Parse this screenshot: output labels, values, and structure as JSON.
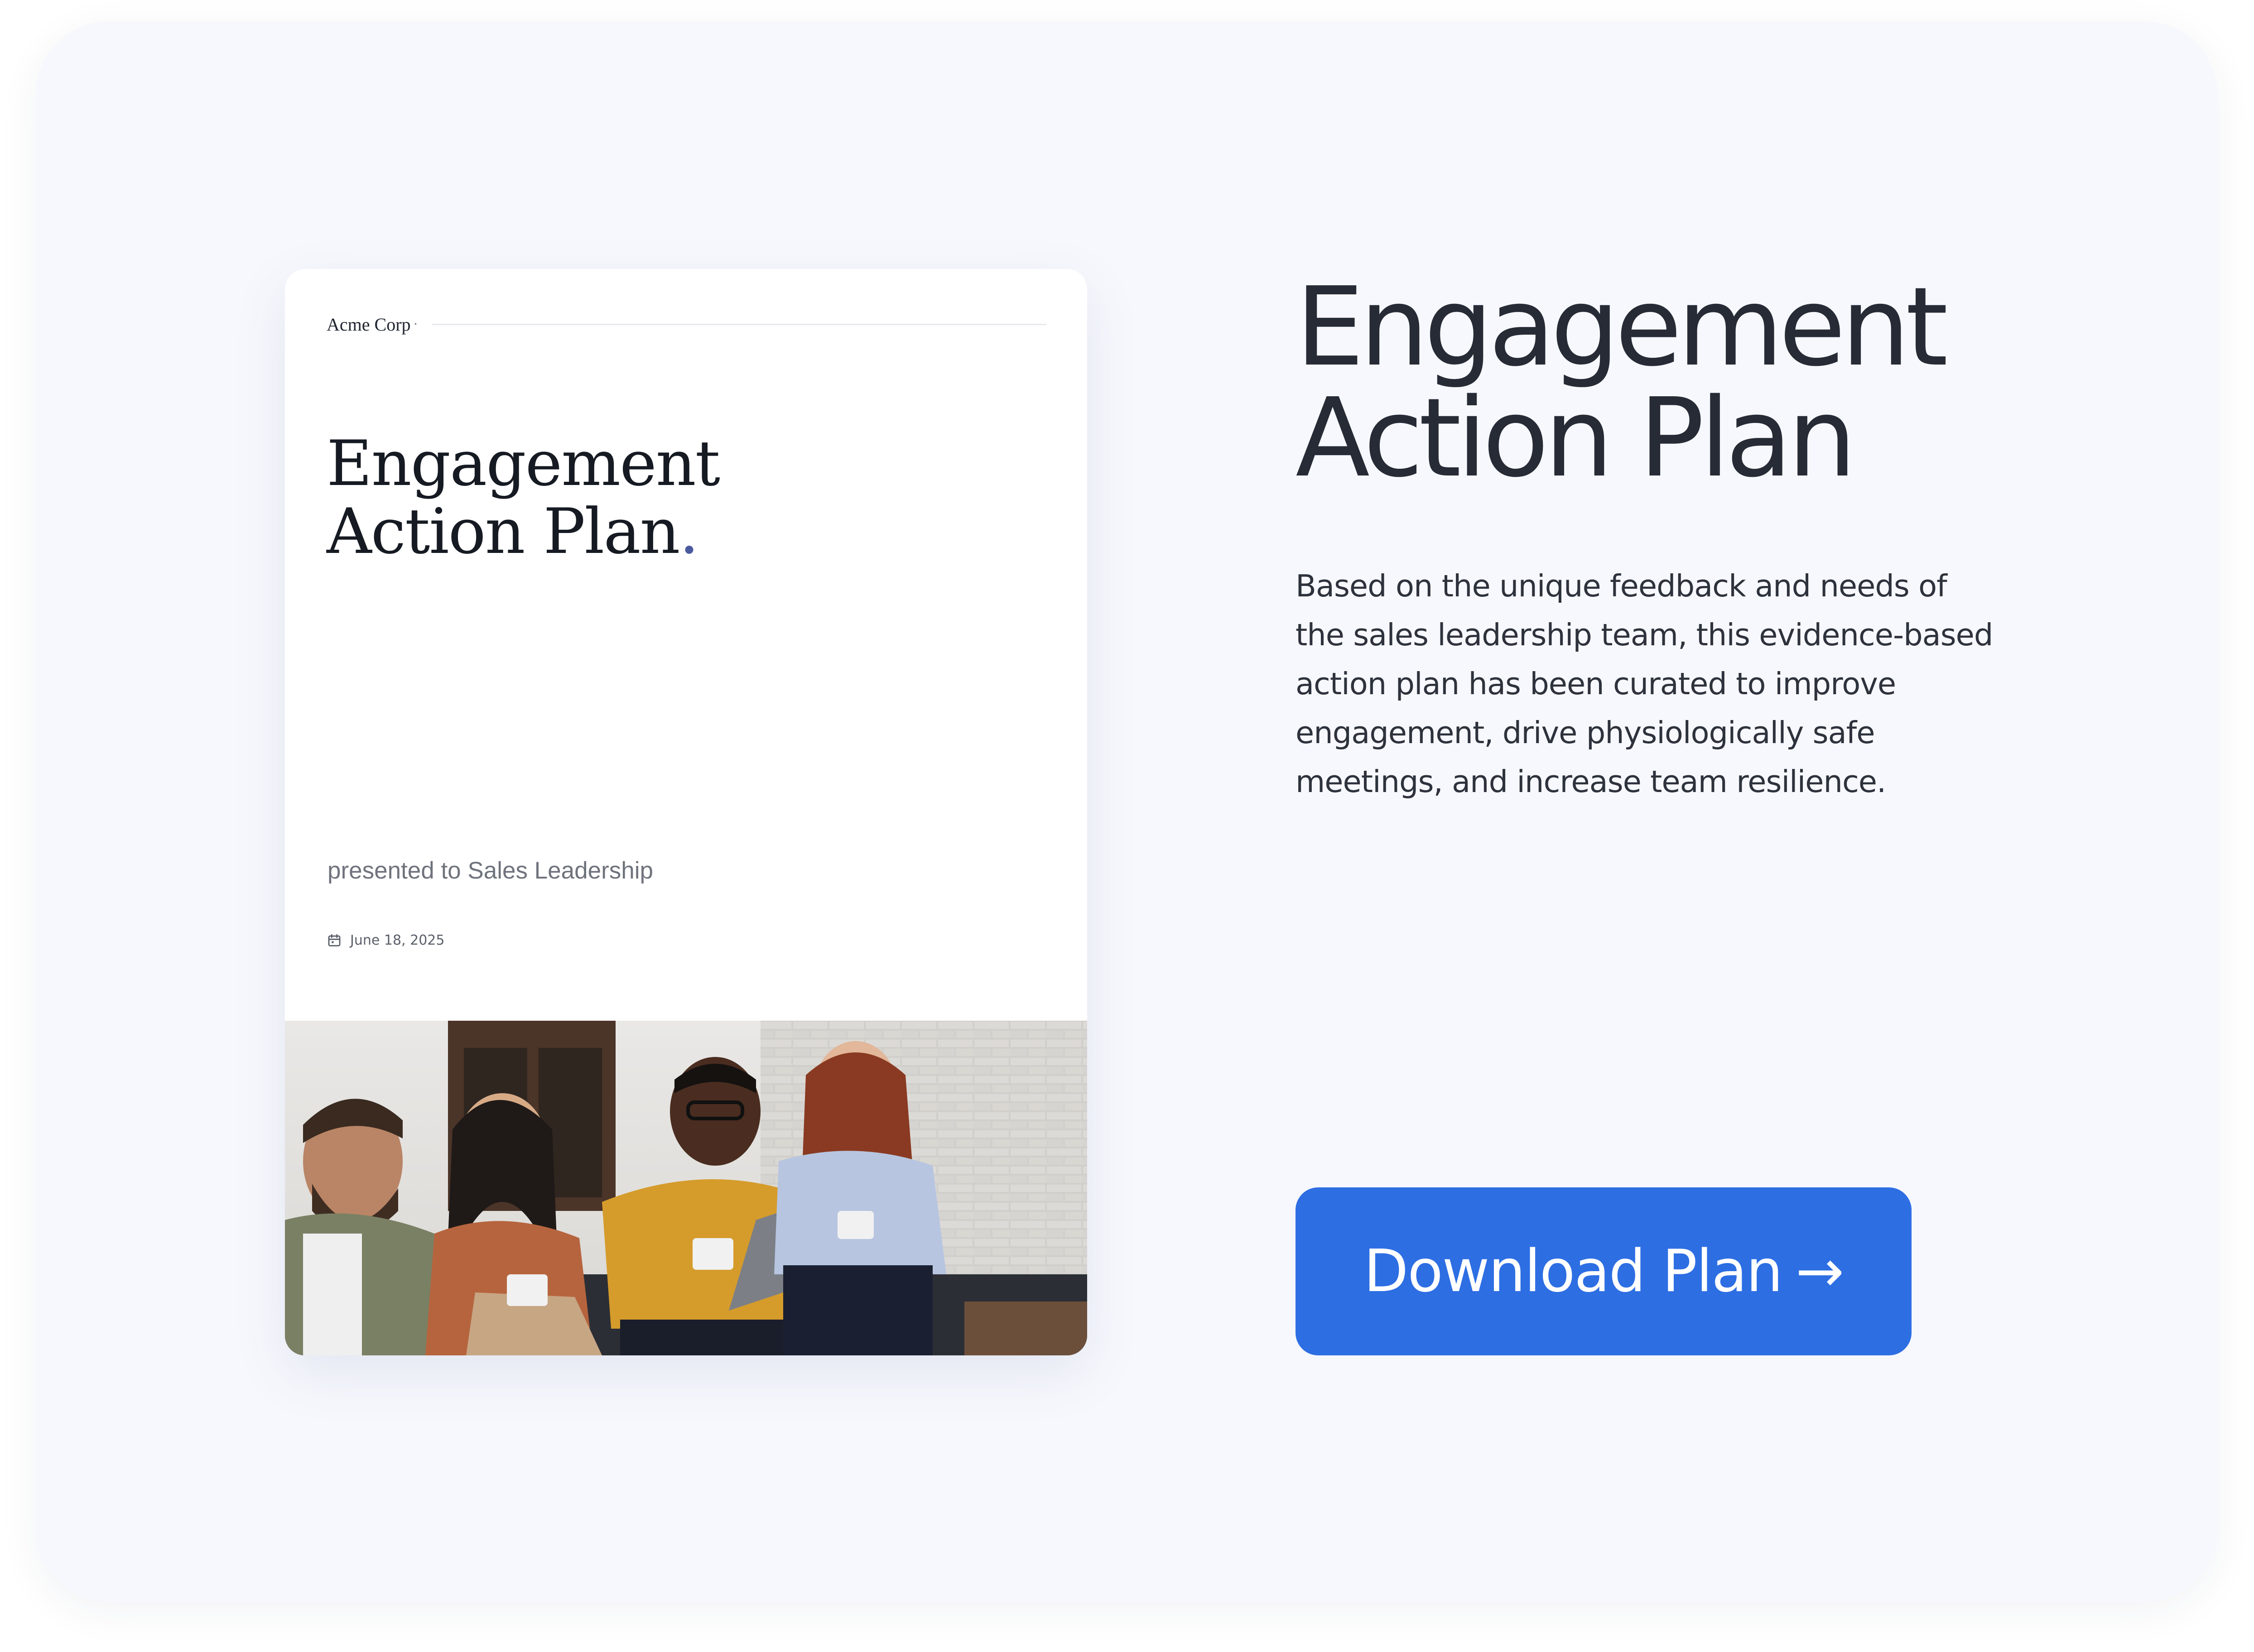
{
  "preview": {
    "company": "Acme Corp",
    "company_dot": "·",
    "title_line1": "Engagement",
    "title_line2": "Action Plan",
    "title_period": ".",
    "subtitle": "presented to Sales Leadership",
    "date": "June 18, 2025",
    "date_icon": "calendar-icon",
    "photo_description": "group-of-four-smiling-coworkers-with-tablet"
  },
  "hero": {
    "title_line1": "Engagement",
    "title_line2": "Action Plan",
    "description": "Based on the unique feedback and needs of the sales leadership team, this evidence-based action plan has been curated to improve engagement, drive physiologically safe meetings, and increase team resilience."
  },
  "cta": {
    "label": "Download Plan",
    "arrow": "→",
    "color": "#2d6ee3"
  },
  "colors": {
    "page_background": "#f7f8fd",
    "heading": "#262b36",
    "accent_dot": "#4a5a9e"
  }
}
